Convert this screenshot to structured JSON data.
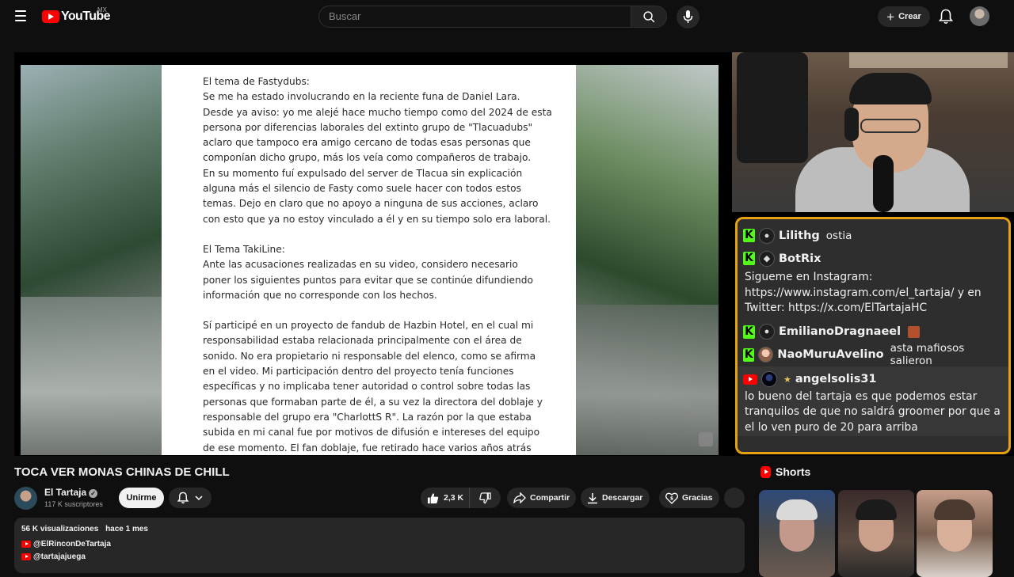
{
  "header": {
    "logo_text": "YouTube",
    "country": "MX",
    "search_placeholder": "Buscar",
    "create_label": "Crear"
  },
  "video": {
    "document_paragraphs": [
      "El tema de Fastydubs:\nSe me ha estado involucrando en la reciente funa de Daniel Lara.\nDesde ya aviso: yo me alejé hace mucho tiempo como del 2024 de esta\npersona por diferencias laborales del extinto grupo de \"Tlacuadubs\"\naclaro que tampoco era amigo cercano de todas esas personas que\ncomponían dicho grupo, más los veía como compañeros de trabajo.\nEn su momento fuí expulsado del server de Tlacua sin explicación\nalguna más el silencio de Fasty como suele hacer con todos estos\ntemas. Dejo en claro que no apoyo a ninguna de sus acciones, aclaro\ncon esto que ya no estoy vinculado a él y en su tiempo solo era laboral.",
      "El Tema TakiLine:\nAnte las acusaciones realizadas en su video, considero necesario\nponer los siguientes puntos para evitar que se continúe difundiendo\ninformación que no corresponde con los hechos.",
      "Sí participé en un proyecto de fandub de Hazbin Hotel, en el cual mi\nresponsabilidad estaba relacionada principalmente con el área de\nsonido. No era propietario ni responsable del elenco, como se afirma\nen el video. Mi participación dentro del proyecto tenía funciones\nespecíficas y no implicaba tener autoridad o control sobre todas las\npersonas que formaban parte de él, a su vez la directora del doblaje y\nresponsable del grupo era \"CharlottS R\". La razón por la que estaba\nsubida en mi canal fue por motivos de difusión e intereses del equipo\nde ese momento. El fan doblaje, fue retirado hace varios años atrás"
    ]
  },
  "chat": {
    "messages": [
      {
        "platform": "kick",
        "avatar": "user-icon",
        "user": "Lilithg",
        "text": "ostia"
      },
      {
        "platform": "kick",
        "avatar": "bot-icon",
        "user": "BotRix",
        "text": "Sigueme en Instagram: https://www.instagram.com/el_tartaja/ y en Twitter: https://x.com/ElTartajaHC"
      },
      {
        "platform": "kick",
        "avatar": "user-icon",
        "user": "EmilianoDragnaeel",
        "text": ""
      },
      {
        "platform": "kick",
        "avatar": "photo",
        "user": "NaoMuruAvelino",
        "text": "asta mafiosos salieron"
      },
      {
        "platform": "youtube",
        "avatar": "photo",
        "user": "angelsolis31",
        "text": "lo bueno del tartaja es que podemos estar tranquilos de que no saldrá groomer por que a el lo ven puro de 20 para arriba"
      }
    ]
  },
  "meta": {
    "title": "TOCA VER MONAS CHINAS DE CHILL",
    "channel_name": "El Tartaja",
    "subscribers": "117 K suscriptores",
    "join_label": "Unirme",
    "likes": "2,3 K",
    "share_label": "Compartir",
    "download_label": "Descargar",
    "thanks_label": "Gracias"
  },
  "description": {
    "views": "56 K visualizaciones",
    "date": "hace 1 mes",
    "links": [
      "@ElRinconDeTartaja",
      "@tartajajuega"
    ]
  },
  "shorts": {
    "heading": "Shorts"
  },
  "colors": {
    "accent_red": "#ff0000",
    "kick_green": "#53fc18",
    "chat_border": "#e5a10e"
  }
}
